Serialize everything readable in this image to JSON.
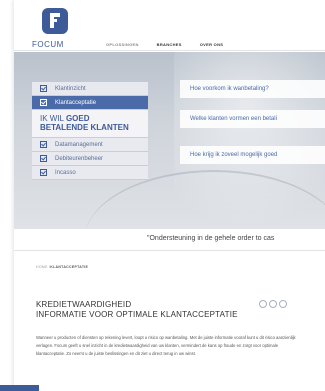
{
  "header": {
    "brand": "FOCUM",
    "nav": [
      {
        "label": "OPLOSSINGEN",
        "active": false
      },
      {
        "label": "BRANCHES",
        "active": true
      },
      {
        "label": "OVER ONS",
        "active": true
      }
    ]
  },
  "menu": {
    "items_top": [
      {
        "label": "Klantinzicht",
        "active": false
      },
      {
        "label": "Klantacceptatie",
        "active": true
      }
    ],
    "feature_line1_prefix": "IK WIL",
    "feature_line1_bold": "GOED",
    "feature_line2": "BETALENDE KLANTEN",
    "items_bottom": [
      {
        "label": "Datamanagement"
      },
      {
        "label": "Debiteurenbeheer"
      },
      {
        "label": "Incasso"
      }
    ]
  },
  "questions": [
    "Hoe voorkom ik wanbetaling?",
    "Welke klanten vormen een betali",
    "Hoe krijg ik zoveel mogelijk goed"
  ],
  "quote": "\"Ondersteuning in de gehele order to cas",
  "breadcrumb": {
    "home": "HOME /",
    "current": "KLANTACCEPTATIE"
  },
  "article": {
    "title_line1": "KREDIETWAARDIGHEID",
    "title_line2": "INFORMATIE VOOR OPTIMALE KLANTACCEPTATIE",
    "body": "Wanneer u producten of diensten op rekening levert, loopt u risico op wanbetaling. Met de juiste informatie vooraf kunt u dit risico aanzienlijk verlagen. Focum geeft u snel inzicht in de kredietwaardigheid van uw klanten, vermindert de kans op fraude en zorgt voor optimale klantacceptatie. Zo neemt u de juiste beslissingen en dit ziet u direct terug in uw winst."
  },
  "colors": {
    "brand": "#3d5b98",
    "active_menu": "#4a6aa8"
  }
}
